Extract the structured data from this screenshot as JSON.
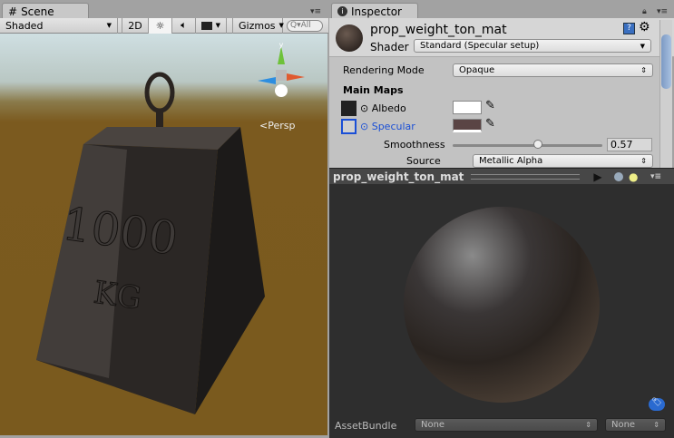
{
  "scene": {
    "tab_label": "Scene",
    "shading_mode": "Shaded",
    "btn_2d": "2D",
    "gizmos_label": "Gizmos",
    "search_placeholder": "All",
    "camera_label": "Persp",
    "object_text_1": "1000",
    "object_text_2": "KG"
  },
  "inspector": {
    "tab_label": "Inspector",
    "material_name": "prop_weight_ton_mat",
    "shader_label": "Shader",
    "shader_value": "Standard (Specular setup)",
    "rendering_mode_label": "Rendering Mode",
    "rendering_mode_value": "Opaque",
    "main_maps_label": "Main Maps",
    "albedo_label": "Albedo",
    "albedo_color": "#ffffff",
    "specular_label": "Specular",
    "specular_color": "#5a4444",
    "smoothness_label": "Smoothness",
    "smoothness_value": "0.57",
    "smoothness_fraction": 0.57,
    "source_label": "Source",
    "source_value": "Metallic Alpha"
  },
  "preview": {
    "title": "prop_weight_ton_mat",
    "asset_bundle_label": "AssetBundle",
    "asset_bundle_value": "None",
    "asset_bundle_variant": "None"
  },
  "colors": {
    "accent_blue": "#1a4fd6",
    "sky": "#c9d8db",
    "ground": "#7b5a1f"
  }
}
